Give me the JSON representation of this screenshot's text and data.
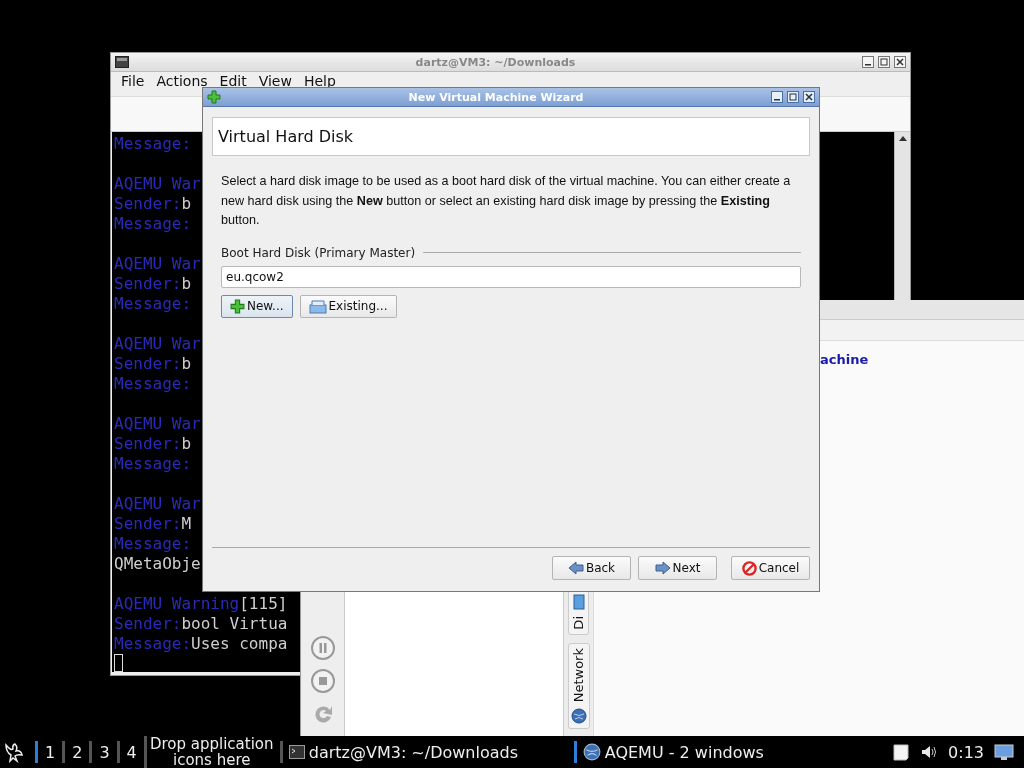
{
  "terminal_window": {
    "title": "dartz@VM3: ~/Downloads",
    "menu": [
      "File",
      "Actions",
      "Edit",
      "View",
      "Help"
    ],
    "output": [
      [
        {
          "tag": "Message:"
        }
      ],
      [
        {
          "tag": "AQEMU War"
        },
        {
          "tag": "Sender:",
          "text": "b"
        },
        {
          "tag": "Message:"
        }
      ],
      [
        {
          "tag": "AQEMU War"
        },
        {
          "tag": "Sender:",
          "text": "b"
        },
        {
          "tag": "Message:"
        }
      ],
      [
        {
          "tag": "AQEMU War"
        },
        {
          "tag": "Sender:",
          "text": "b"
        },
        {
          "tag": "Message:"
        }
      ],
      [
        {
          "tag": "AQEMU War"
        },
        {
          "tag": "Sender:",
          "text": "b"
        },
        {
          "tag": "Message:"
        }
      ],
      [
        {
          "tag": "AQEMU War"
        },
        {
          "tag": "Sender:",
          "text": "M"
        },
        {
          "tag": "Message:"
        },
        {
          "text": "QMetaObje"
        }
      ],
      [
        {
          "tag": "AQEMU Warning",
          "text": "[115]"
        },
        {
          "tag": "Sender:",
          "text": "bool Virtua"
        },
        {
          "tag": "Message:",
          "text": "Uses compa"
        }
      ]
    ]
  },
  "aqemu_window": {
    "item_text": "achine",
    "tabs": [
      {
        "label": "Di",
        "kind": "disk"
      },
      {
        "label": "Network",
        "kind": "network"
      }
    ]
  },
  "wizard": {
    "title": "New Virtual Machine Wizard",
    "page_title": "Virtual Hard Disk",
    "description": "Select a hard disk image to be used as a boot hard disk of the virtual machine. You can either create a new hard disk using the **New** button or select an existing hard disk image by pressing the **Existing** button.",
    "group_label": "Boot Hard Disk (Primary Master)",
    "disk_field": {
      "value": "eu.qcow2"
    },
    "disk_buttons": [
      {
        "label": "New...",
        "kind": "new",
        "focused": true
      },
      {
        "label": "Existing...",
        "kind": "existing",
        "focused": false
      }
    ],
    "nav_buttons": [
      {
        "label": "Back",
        "kind": "back"
      },
      {
        "label": "Next",
        "kind": "next"
      },
      {
        "label": "Cancel",
        "kind": "cancel"
      }
    ]
  },
  "taskbar": {
    "workspaces": [
      {
        "label": "1",
        "selected": true
      },
      {
        "label": "2",
        "selected": false
      },
      {
        "label": "3",
        "selected": false
      },
      {
        "label": "4",
        "selected": false
      }
    ],
    "drop_hint": "Drop application icons here",
    "tasks": [
      {
        "label": "dartz@VM3: ~/Downloads",
        "kind": "terminal",
        "selected": false
      },
      {
        "label": "AQEMU - 2 windows",
        "kind": "aqemu",
        "selected": true
      }
    ],
    "clock": "0:13"
  }
}
